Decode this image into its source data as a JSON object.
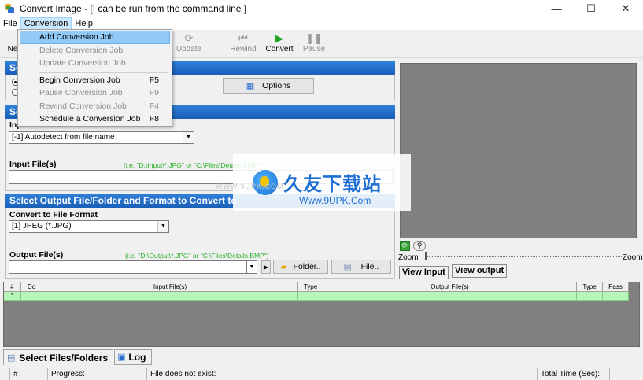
{
  "window": {
    "title": "Convert Image - [I can be run from the command line ]",
    "minimize": "—",
    "maximize": "☐",
    "close": "✕"
  },
  "menu": {
    "file": "File",
    "conversion": "Conversion",
    "help": "Help"
  },
  "toolbar": {
    "new_partial": "Ne",
    "update": "Update",
    "rewind": "Rewind",
    "convert": "Convert",
    "pause": "Pause"
  },
  "dropdown": {
    "items": [
      {
        "label": "Add Conversion Job",
        "shortcut": ""
      },
      {
        "label": "Delete Conversion Job",
        "shortcut": ""
      },
      {
        "label": "Update Conversion Job",
        "shortcut": ""
      },
      {
        "label": "Begin Conversion Job",
        "shortcut": "F5"
      },
      {
        "label": "Pause Conversion Job",
        "shortcut": "F9"
      },
      {
        "label": "Rewind Conversion Job",
        "shortcut": "F4"
      },
      {
        "label": "Schedule a Conversion Job",
        "shortcut": "F8"
      }
    ]
  },
  "section1": {
    "title_partial": "Se",
    "options_button": "Options"
  },
  "section2": {
    "title_partial": "Se",
    "input_format_label": "Input File Format",
    "input_format_value": "[-1] Autodetect from file name",
    "input_files_label": "Input File(s)",
    "input_files_hint": "(i.e. \"D:\\Input\\*.JPG\" or \"C:\\Files\\Details.BMP\")"
  },
  "section3": {
    "title": "Select Output File/Folder and Format to Convert to",
    "convert_format_label": "Convert to File Format",
    "convert_format_value": "[1] JPEG (*.JPG)",
    "output_files_label": "Output File(s)",
    "output_files_hint": "(i.e. \"D:\\Output\\*.JPG\" or \"C:\\Files\\Details.BMP\")",
    "folder_button": "Folder..",
    "file_button": "File.."
  },
  "preview": {
    "zoom_left": "Zoom",
    "zoom_right": "Zoom",
    "view_input": "View Input",
    "view_output": "View output"
  },
  "grid": {
    "columns": [
      "#",
      "Do",
      "Input File(s)",
      "Type",
      "Output File(s)",
      "Type",
      "Pass"
    ],
    "new_row_marker": "*"
  },
  "bottom_tabs": {
    "select_files": "Select Files/Folders",
    "log": "Log"
  },
  "status": {
    "hash": "#",
    "progress": "Progress:",
    "message": "File does not exist:",
    "total_time": "Total Time (Sec):"
  },
  "watermark": {
    "brand_cn": "久友下载站",
    "url": "Www.9UPK.Com",
    "faint": "WWW.9UPK.COM"
  }
}
